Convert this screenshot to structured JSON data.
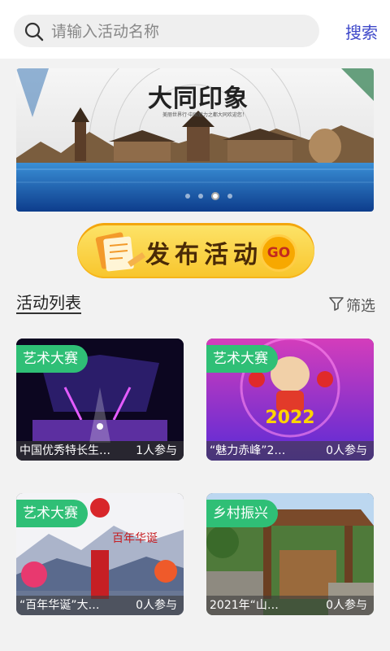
{
  "search": {
    "placeholder": "请输入活动名称",
    "button_label": "搜索"
  },
  "banner": {
    "title": "大同印象",
    "subtitle": "美丽世界行·中国魅力之都大同欢迎您！",
    "slide_count": 4,
    "active_slide": 3
  },
  "publish": {
    "label": "发布活动",
    "badge": "GO"
  },
  "list": {
    "heading": "活动列表",
    "filter_label": "筛选"
  },
  "cards": [
    {
      "tag": "艺术大赛",
      "title": "中国优秀特长生…",
      "count": "1人参与"
    },
    {
      "tag": "艺术大赛",
      "title": "“魅力赤峰”2…",
      "count": "0人参与"
    },
    {
      "tag": "艺术大赛",
      "title": "“百年华诞”大…",
      "count": "0人参与"
    },
    {
      "tag": "乡村振兴",
      "title": "2021年“山…",
      "count": "0人参与"
    }
  ],
  "colors": {
    "accent": "#3d47c9",
    "tag_green": "#2fbf76",
    "publish_yellow": "#f8c52c"
  }
}
